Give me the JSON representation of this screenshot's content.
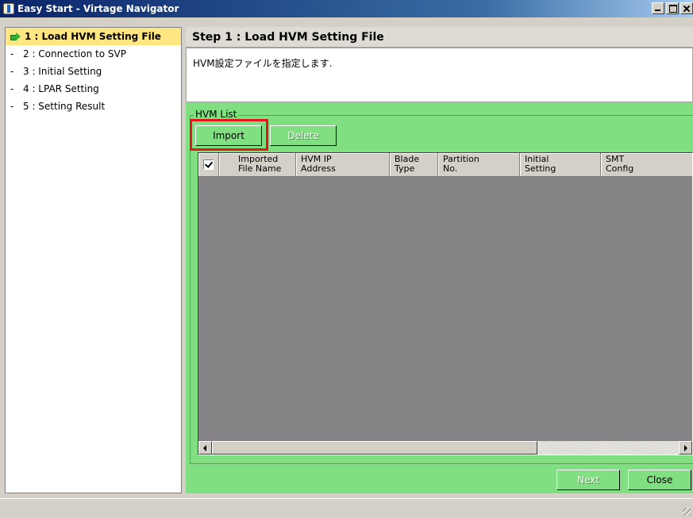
{
  "window": {
    "title": "Easy Start - Virtage Navigator"
  },
  "nav": {
    "items": [
      {
        "marker": "",
        "label": "1 : Load HVM Setting File",
        "active": true
      },
      {
        "marker": "-",
        "label": "2 : Connection to SVP",
        "active": false
      },
      {
        "marker": "-",
        "label": "3 : Initial Setting",
        "active": false
      },
      {
        "marker": "-",
        "label": "4 : LPAR Setting",
        "active": false
      },
      {
        "marker": "-",
        "label": "5 : Setting Result",
        "active": false
      }
    ]
  },
  "step": {
    "title": "Step 1 : Load HVM Setting File",
    "description": "HVM設定ファイルを指定します."
  },
  "hvm_list": {
    "group_label": "HVM List",
    "import_label": "Import",
    "delete_label": "Delete",
    "columns": [
      {
        "line1": "",
        "line2": ""
      },
      {
        "line1": "Imported",
        "line2": "File Name"
      },
      {
        "line1": "HVM IP",
        "line2": "Address"
      },
      {
        "line1": "Blade",
        "line2": "Type"
      },
      {
        "line1": "Partition",
        "line2": "No."
      },
      {
        "line1": "Initial",
        "line2": "Setting"
      },
      {
        "line1": "SMT",
        "line2": "Config"
      }
    ],
    "select_all_checked": true,
    "rows": []
  },
  "footer": {
    "next_label": "Next",
    "close_label": "Close"
  },
  "colors": {
    "panel_green": "#80df80",
    "active_nav": "#ffe680",
    "highlight_red": "#e8141c",
    "list_background": "#858386"
  },
  "icons": {
    "window": "app-icon",
    "active_step": "green-arrow-icon"
  }
}
